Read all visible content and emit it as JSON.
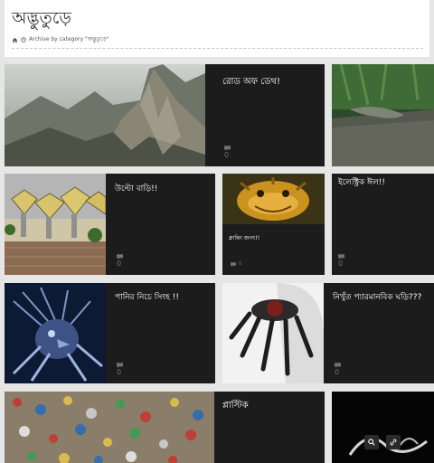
{
  "header": {
    "title": "অদ্ভুতুড়ে",
    "breadcrumb": "Archive by category \"অদ্ভুতুড়ে\""
  },
  "posts": [
    {
      "title": "রোড অফ ডেথ!",
      "comments": "0"
    },
    {
      "title": "",
      "comments": ""
    },
    {
      "title": "উল্টো বাড়ি!!",
      "comments": "0"
    },
    {
      "title": "ক্লান্তিং জগৎ!!",
      "comments": "0"
    },
    {
      "title": "ইলেক্ট্রিক ঈল!!",
      "comments": "0"
    },
    {
      "title": "পানির নিচে সিংহ !!",
      "comments": "0"
    },
    {
      "title": "নিখুঁত প্যারমানবিক ঘড়ি???",
      "comments": "0"
    },
    {
      "title": "প্লাস্টিক",
      "comments": ""
    }
  ],
  "colors": {
    "card_bg": "#1c1c1c",
    "page_bg": "#e6e6e6",
    "muted": "#707070"
  },
  "icons": [
    "home-icon",
    "clock-icon",
    "comment-icon",
    "search-icon",
    "link-icon"
  ]
}
